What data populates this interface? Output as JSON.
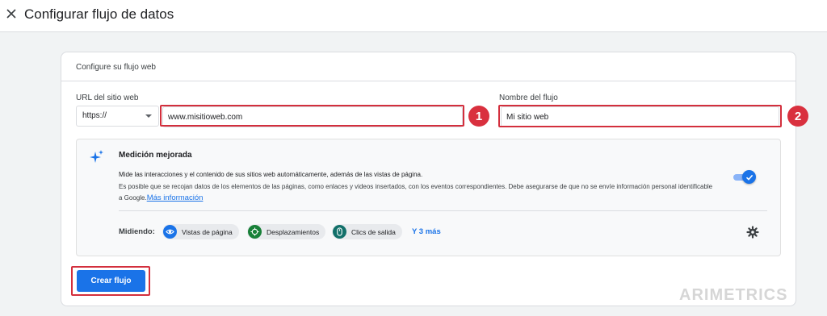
{
  "header": {
    "title": "Configurar flujo de datos",
    "close_icon": "close-icon"
  },
  "card": {
    "header": "Configure su flujo web"
  },
  "form": {
    "url_label": "URL del sitio web",
    "protocol": "https://",
    "url_value": "www.misitioweb.com",
    "name_label": "Nombre del flujo",
    "name_value": "Mi sitio web",
    "badges": [
      "1",
      "2"
    ]
  },
  "enhanced": {
    "title": "Medición mejorada",
    "desc_main": "Mide las interacciones y el contenido de sus sitios web automáticamente, además de las vistas de página.",
    "desc_secondary": "Es posible que se recojan datos de los elementos de las páginas, como enlaces y videos insertados, con los eventos correspondientes. Debe asegurarse de que no se envíe información personal identificable a Google.",
    "link": "Más información",
    "toggle_on": true,
    "measuring_label": "Midiendo:",
    "chips": [
      {
        "label": "Vistas de página",
        "icon": "eye-icon",
        "color": "#1a73e8"
      },
      {
        "label": "Desplazamientos",
        "icon": "crosshair-icon",
        "color": "#188038"
      },
      {
        "label": "Clics de salida",
        "icon": "mouse-icon",
        "color": "#12706a"
      }
    ],
    "more": "Y 3 más"
  },
  "actions": {
    "create": "Crear flujo"
  },
  "watermark": "ARIMETRICS",
  "colors": {
    "accent": "#1a73e8",
    "highlight": "#d32f3d"
  }
}
